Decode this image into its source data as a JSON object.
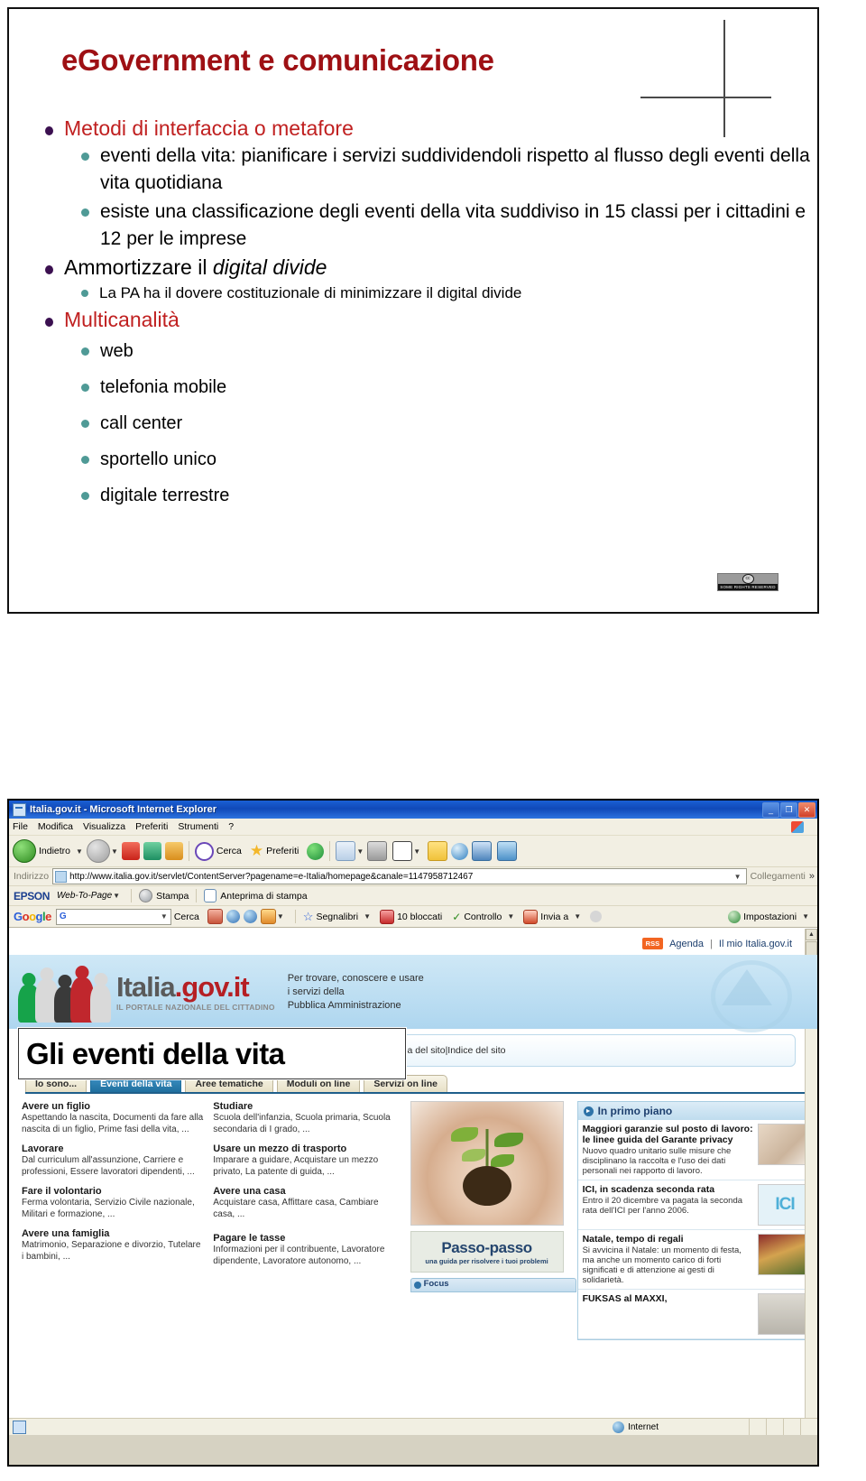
{
  "slide": {
    "title": "eGovernment e comunicazione",
    "bullets": [
      {
        "level": 1,
        "style": "red",
        "text": "Metodi di interfaccia o metafore"
      },
      {
        "level": 2,
        "style": "big",
        "text": "eventi della vita: pianificare i servizi suddividendoli rispetto al flusso degli eventi della vita quotidiana"
      },
      {
        "level": 2,
        "style": "big",
        "text": "esiste una classificazione degli eventi della vita suddiviso in 15 classi per i cittadini e 12 per le imprese"
      },
      {
        "level": 1,
        "style": "dark",
        "text_pre": "Ammortizzare il ",
        "text_italic": "digital divide"
      },
      {
        "level": 2,
        "style": "small",
        "text": "La PA ha il dovere costituzionale di minimizzare il digital divide"
      },
      {
        "level": 1,
        "style": "red",
        "text": "Multicanalità"
      },
      {
        "level": 2,
        "style": "med",
        "text": "web"
      },
      {
        "level": 2,
        "style": "med",
        "text": "telefonia mobile"
      },
      {
        "level": 2,
        "style": "med",
        "text": "call center"
      },
      {
        "level": 2,
        "style": "med",
        "text": "sportello unico"
      },
      {
        "level": 2,
        "style": "med",
        "text": "digitale terrestre"
      }
    ],
    "cc_badge": {
      "mark": "cc",
      "text": "SOME RIGHTS RESERVED"
    },
    "colors": {
      "title": "#9e1014",
      "level1_red": "#c02020",
      "bullet1": "#3b1050",
      "bullet2": "#4f9a96"
    }
  },
  "browser": {
    "window_title": "Italia.gov.it - Microsoft Internet Explorer",
    "window_buttons": {
      "minimize": "_",
      "restore": "❐",
      "close": "✕"
    },
    "menu": [
      "File",
      "Modifica",
      "Visualizza",
      "Preferiti",
      "Strumenti",
      "?"
    ],
    "toolbar": {
      "back": "Indietro",
      "search": "Cerca",
      "favorites": "Preferiti"
    },
    "address": {
      "label": "Indirizzo",
      "url": "http://www.italia.gov.it/servlet/ContentServer?pagename=e-Italia/homepage&canale=1147958712467",
      "links_label": "Collegamenti",
      "chevron": "»"
    },
    "epson_bar": {
      "brand": "EPSON",
      "web_to_page": "Web-To-Page",
      "print": "Stampa",
      "preview": "Anteprima di stampa"
    },
    "google_bar": {
      "logo": "Google",
      "field_prefix": "G",
      "search": "Cerca",
      "bookmarks": "Segnalibri",
      "blocked": "10 bloccati",
      "check": "Controllo",
      "send_to": "Invia a",
      "settings": "Impostazioni"
    },
    "status": {
      "zone": "Internet"
    }
  },
  "site": {
    "topnav": {
      "rss": "RSS",
      "agenda": "Agenda",
      "separator": "|",
      "mine": "Il mio Italia.gov.it"
    },
    "logo": {
      "name_part1": "Italia",
      "name_dot": ".",
      "name_part2": "gov",
      "name_dot2": ".",
      "name_part3": "it",
      "tagline": "IL PORTALE NAZIONALE DEL CITTADINO"
    },
    "payoff_lines": [
      "Per trovare, conoscere e usare",
      "i servizi della",
      "Pubblica Amministrazione"
    ],
    "overlay_caption": "Gli eventi della vita",
    "overlay_chevron": "»",
    "utility_links": "Guida al portale |Mappa del sito|Indice del sito",
    "tabs": [
      {
        "label": "Io sono...",
        "selected": false
      },
      {
        "label": "Eventi della vita",
        "selected": true
      },
      {
        "label": "Aree tematiche",
        "selected": false
      },
      {
        "label": "Moduli on line",
        "selected": false
      },
      {
        "label": "Servizi on line",
        "selected": false
      }
    ],
    "column1": [
      {
        "title": "Avere un figlio",
        "desc": "Aspettando la nascita, Documenti da fare alla nascita di un figlio, Prime fasi della vita, ..."
      },
      {
        "title": "Lavorare",
        "desc": "Dal curriculum all'assunzione, Carriere e professioni, Essere lavoratori dipendenti, ..."
      },
      {
        "title": "Fare il volontario",
        "desc": "Ferma volontaria, Servizio Civile nazionale, Militari e formazione, ..."
      },
      {
        "title": "Avere una famiglia",
        "desc": "Matrimonio, Separazione e divorzio, Tutelare i bambini, ..."
      }
    ],
    "column2": [
      {
        "title": "Studiare",
        "desc": "Scuola dell'infanzia, Scuola primaria, Scuola secondaria di I grado, ..."
      },
      {
        "title": "Usare un mezzo di trasporto",
        "desc": "Imparare a guidare, Acquistare un mezzo privato, La patente di guida, ..."
      },
      {
        "title": "Avere una casa",
        "desc": "Acquistare casa, Affittare casa, Cambiare casa, ..."
      },
      {
        "title": "Pagare le tasse",
        "desc": "Informazioni per il contribuente, Lavoratore dipendente, Lavoratore autonomo, ..."
      }
    ],
    "promo": {
      "passo_title": "Passo-passo",
      "passo_sub": "una guida per risolvere i tuoi problemi",
      "focus_label": "Focus"
    },
    "sidebar": {
      "header": "In primo piano",
      "news": [
        {
          "title": "Maggiori garanzie sul posto di lavoro: le linee guida del Garante privacy",
          "desc": "Nuovo quadro unitario sulle misure che disciplinano la raccolta e l'uso dei dati personali nei rapporto di lavoro."
        },
        {
          "title": "ICI, in scadenza seconda rata",
          "desc": "Entro il 20 dicembre va pagata la seconda rata dell'ICI per l'anno 2006.",
          "thumb_text": "ICI"
        },
        {
          "title": "Natale, tempo di regali",
          "desc": "Si avvicina il Natale: un momento di festa, ma anche un momento carico di forti significati e di attenzione ai gesti di solidarietà."
        },
        {
          "title": "FUKSAS al MAXXI,",
          "desc": ""
        }
      ]
    }
  }
}
